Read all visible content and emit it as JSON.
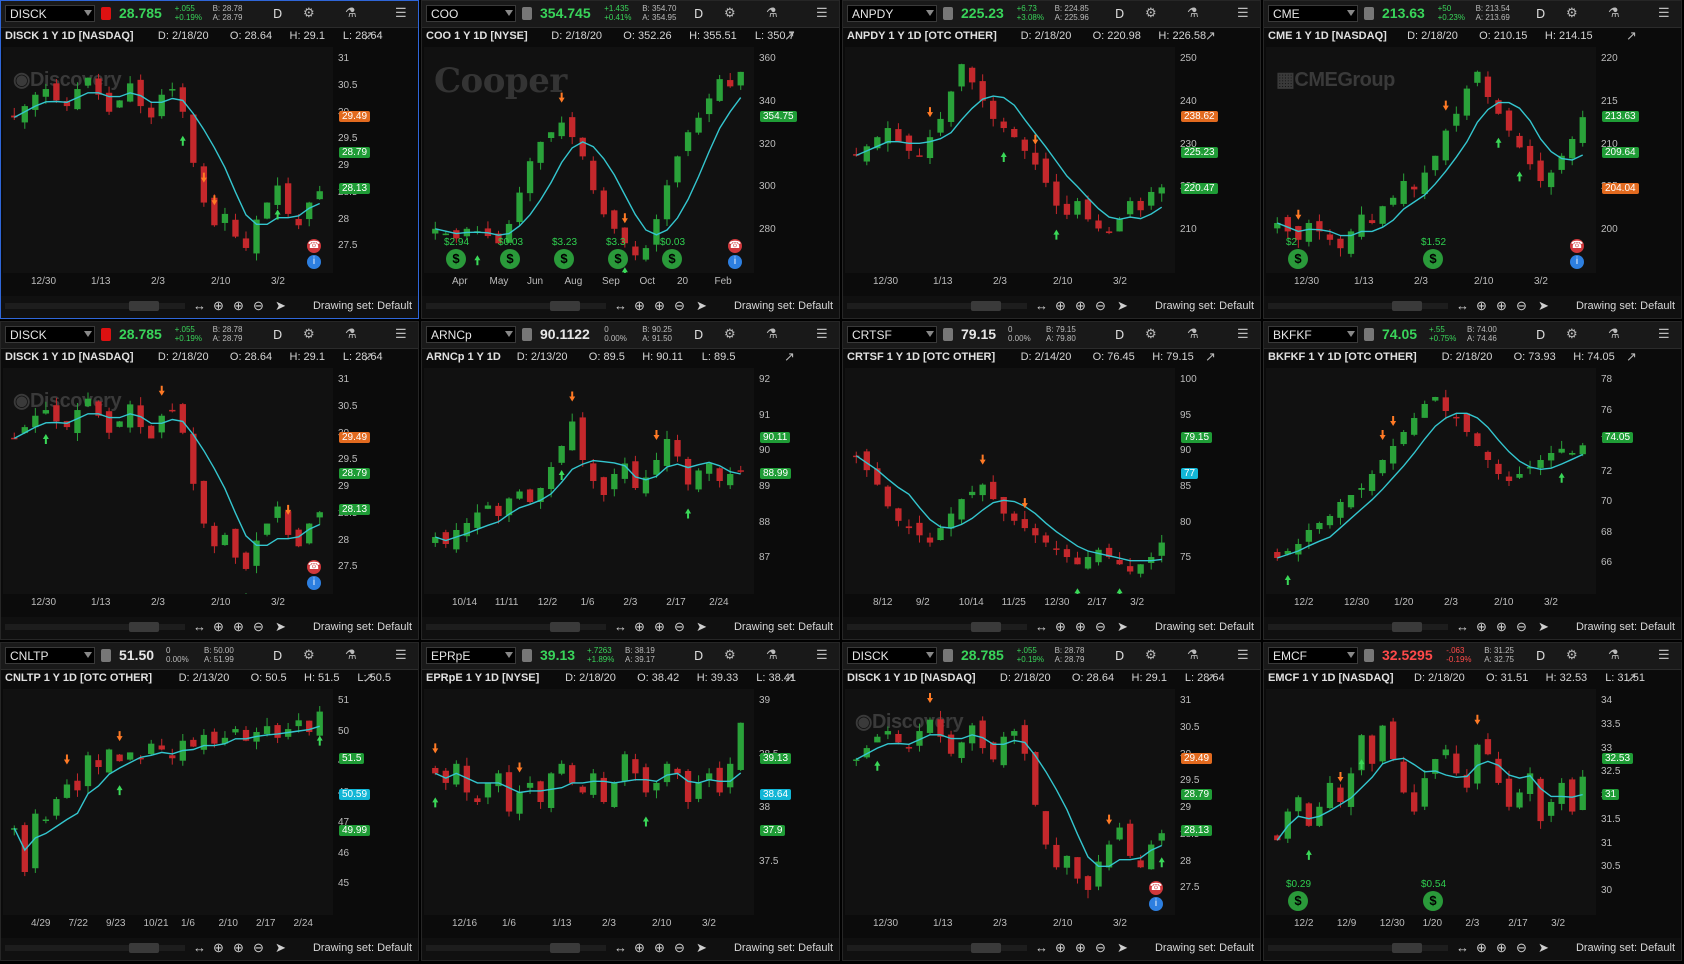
{
  "window": {
    "drawing_set": "Drawing set: Default"
  },
  "colors": {
    "up": "#2aa23a",
    "down": "#c4282c",
    "ma": "#34c6cf",
    "buy_arrow": "#3ad858",
    "sell_arrow": "#ff7a25",
    "green_badge": "#1f9c36",
    "orange_badge": "#e26a1f",
    "cyan_badge": "#12b6d6"
  },
  "icons": [
    "link-icon",
    "gear-icon",
    "flask-icon",
    "menu-icon",
    "drawing-icon",
    "pan-icon",
    "zoom-in-icon",
    "zoom-out-icon",
    "crosshair-icon",
    "cursor-icon",
    "dividend-icon",
    "earnings-icon",
    "buy-arrow-icon",
    "sell-arrow-icon"
  ],
  "panels": [
    {
      "symbol": "DISCK",
      "link_color": "#d11",
      "last": "28.785",
      "chg1": "+.055",
      "chg2": "+0.19%",
      "bid": "B: 28.78",
      "ask": "A: 28.79",
      "agg": "D",
      "title": "DISCK 1 Y 1D [NASDAQ]",
      "date": "D: 2/18/20",
      "open": "O: 28.64",
      "high": "H: 29.1",
      "low": "L: 28.64",
      "logo": "Discovery",
      "y_ticks": [
        "31",
        "30.5",
        "30",
        "29.5",
        "29",
        "28.5",
        "28",
        "27.5"
      ],
      "x_ticks": [
        "12/30",
        "1/13",
        "2/3",
        "2/10",
        "3/2"
      ],
      "badges": [
        {
          "text": "29.49",
          "color": "orange"
        },
        {
          "text": "28.79",
          "color": "green"
        },
        {
          "text": "28.13",
          "color": "green"
        }
      ],
      "dividends": [],
      "earnings": true,
      "chart_data": {
        "type": "candlestick",
        "ylim": [
          27.5,
          31.2
        ],
        "close": [
          30.1,
          30.3,
          30.5,
          30.6,
          30.4,
          30.3,
          30.6,
          30.8,
          30.5,
          30.2,
          30.4,
          30.7,
          30.3,
          30.1,
          30.5,
          30.6,
          30.2,
          29.3,
          28.6,
          28.2,
          28.4,
          28.0,
          27.8,
          28.3,
          28.6,
          28.9,
          28.4,
          28.2,
          28.6,
          28.8
        ]
      }
    },
    {
      "symbol": "COO",
      "link_color": "#777",
      "last": "354.745",
      "chg1": "+1.435",
      "chg2": "+0.41%",
      "bid": "B: 354.70",
      "ask": "A: 354.95",
      "agg": "D",
      "title": "COO 1 Y 1D [NYSE]",
      "date": "D: 2/18/20",
      "open": "O: 352.26",
      "high": "H: 355.51",
      "low": "L: 350.7",
      "logo": "Cooper",
      "y_ticks": [
        "360",
        "340",
        "320",
        "300",
        "280"
      ],
      "x_ticks": [
        "Apr",
        "May",
        "Jun",
        "Aug",
        "Sep",
        "Oct",
        "20",
        "Feb"
      ],
      "badges": [
        {
          "text": "354.75",
          "color": "green"
        }
      ],
      "dividends": [
        "$2.94",
        "$0.03",
        "$3.23",
        "$3.3",
        "$0.03"
      ],
      "earnings": true,
      "chart_data": {
        "type": "candlestick",
        "ylim": [
          275,
          362
        ],
        "close": [
          290,
          288,
          286,
          290,
          289,
          287,
          284,
          292,
          305,
          318,
          326,
          330,
          334,
          328,
          320,
          306,
          296,
          290,
          284,
          279,
          282,
          294,
          308,
          320,
          330,
          336,
          344,
          352,
          349,
          355
        ]
      }
    },
    {
      "symbol": "ANPDY",
      "link_color": "#777",
      "last": "225.23",
      "chg1": "+6.73",
      "chg2": "+3.08%",
      "bid": "B: 224.85",
      "ask": "A: 225.96",
      "agg": "D",
      "title": "ANPDY 1 Y 1D [OTC OTHER]",
      "date": "D: 2/18/20",
      "open": "O: 220.98",
      "high": "H: 226.58",
      "low": "",
      "logo": "",
      "y_ticks": [
        "250",
        "240",
        "230",
        "220",
        "210"
      ],
      "x_ticks": [
        "12/30",
        "1/13",
        "2/3",
        "2/10",
        "3/2"
      ],
      "badges": [
        {
          "text": "238.62",
          "color": "orange"
        },
        {
          "text": "225.23",
          "color": "green"
        },
        {
          "text": "220.47",
          "color": "green"
        }
      ],
      "dividends": [],
      "earnings": false,
      "chart_data": {
        "type": "candlestick",
        "ylim": [
          208,
          254
        ],
        "close": [
          232,
          234,
          236,
          238,
          235,
          233,
          232,
          236,
          240,
          246,
          252,
          248,
          244,
          240,
          238,
          236,
          233,
          230,
          226,
          221,
          219,
          222,
          218,
          216,
          215,
          218,
          222,
          220,
          224,
          225
        ]
      }
    },
    {
      "symbol": "CME",
      "link_color": "#777",
      "last": "213.63",
      "chg1": "+50",
      "chg2": "+0.23%",
      "bid": "B: 213.54",
      "ask": "A: 213.69",
      "agg": "D",
      "title": "CME 1 Y 1D [NASDAQ]",
      "date": "D: 2/18/20",
      "open": "O: 210.15",
      "high": "H: 214.15",
      "low": "",
      "logo": "CMEGroup",
      "y_ticks": [
        "220",
        "215",
        "210",
        "205",
        "200"
      ],
      "x_ticks": [
        "12/30",
        "1/13",
        "2/3",
        "2/10",
        "3/2"
      ],
      "badges": [
        {
          "text": "213.63",
          "color": "green"
        },
        {
          "text": "209.64",
          "color": "green"
        },
        {
          "text": "204.04",
          "color": "orange"
        }
      ],
      "dividends": [
        "$2",
        "$1.52"
      ],
      "earnings": true,
      "chart_data": {
        "type": "candlestick",
        "ylim": [
          196,
          221
        ],
        "close": [
          201,
          200,
          199,
          201,
          200,
          199,
          198,
          200,
          202,
          201,
          203,
          204,
          206,
          205,
          207,
          209,
          212,
          214,
          217,
          219,
          216,
          214,
          212,
          210,
          208,
          206,
          207,
          209,
          211,
          213.6
        ]
      }
    },
    {
      "symbol": "DISCK",
      "link_color": "#d11",
      "last": "28.785",
      "chg1": "+.055",
      "chg2": "+0.19%",
      "bid": "B: 28.78",
      "ask": "A: 28.79",
      "agg": "D",
      "title": "DISCK 1 Y 1D [NASDAQ]",
      "date": "D: 2/18/20",
      "open": "O: 28.64",
      "high": "H: 29.1",
      "low": "L: 28.64",
      "logo": "Discovery",
      "y_ticks": [
        "31",
        "30.5",
        "30",
        "29.5",
        "29",
        "28.5",
        "28",
        "27.5"
      ],
      "x_ticks": [
        "12/30",
        "1/13",
        "2/3",
        "2/10",
        "3/2"
      ],
      "badges": [
        {
          "text": "29.49",
          "color": "orange"
        },
        {
          "text": "28.79",
          "color": "green"
        },
        {
          "text": "28.13",
          "color": "green"
        }
      ],
      "dividends": [],
      "earnings": true,
      "chart_data": {
        "type": "candlestick",
        "ylim": [
          27.5,
          31.2
        ],
        "close": [
          30.1,
          30.3,
          30.5,
          30.6,
          30.4,
          30.3,
          30.6,
          30.8,
          30.5,
          30.2,
          30.4,
          30.7,
          30.3,
          30.1,
          30.5,
          30.6,
          30.2,
          29.3,
          28.6,
          28.2,
          28.4,
          28.0,
          27.8,
          28.3,
          28.6,
          28.9,
          28.4,
          28.2,
          28.6,
          28.8
        ]
      }
    },
    {
      "symbol": "ARNCp",
      "link_color": "#777",
      "last": "90.1122",
      "chg1": "0",
      "chg2": "0.00%",
      "bid": "B: 90.25",
      "ask": "A: 91.50",
      "agg": "D",
      "title": "ARNCp 1 Y 1D",
      "date": "D: 2/13/20",
      "open": "O: 89.5",
      "high": "H: 90.11",
      "low": "L: 89.5",
      "logo": "",
      "y_ticks": [
        "92",
        "91",
        "90",
        "89",
        "88",
        "87"
      ],
      "x_ticks": [
        "10/14",
        "11/11",
        "12/2",
        "1/6",
        "2/3",
        "2/17",
        "2/24"
      ],
      "badges": [
        {
          "text": "90.11",
          "color": "green"
        },
        {
          "text": "88.99",
          "color": "green"
        }
      ],
      "dividends": [],
      "earnings": false,
      "chart_data": {
        "type": "candlestick",
        "ylim": [
          86.8,
          92.8
        ],
        "close": [
          88.2,
          88.0,
          88.4,
          88.6,
          88.9,
          89.1,
          88.8,
          89.3,
          89.5,
          89.2,
          89.6,
          90.2,
          90.8,
          91.5,
          90.4,
          89.8,
          89.4,
          90.0,
          90.3,
          89.6,
          89.9,
          90.4,
          91.0,
          90.5,
          89.7,
          90.1,
          90.3,
          89.8,
          90.0,
          90.1
        ]
      }
    },
    {
      "symbol": "CRTSF",
      "link_color": "#777",
      "last": "79.15",
      "chg1": "0",
      "chg2": "0.00%",
      "bid": "B: 79.15",
      "ask": "A: 79.80",
      "agg": "D",
      "title": "CRTSF 1 Y 1D [OTC OTHER]",
      "date": "D: 2/14/20",
      "open": "O: 76.45",
      "high": "H: 79.15",
      "low": "",
      "logo": "",
      "y_ticks": [
        "100",
        "95",
        "90",
        "85",
        "80",
        "75"
      ],
      "x_ticks": [
        "8/12",
        "9/2",
        "10/14",
        "11/25",
        "12/30",
        "2/17",
        "3/2"
      ],
      "badges": [
        {
          "text": "79.15",
          "color": "green"
        },
        {
          "text": "77",
          "color": "cyan"
        }
      ],
      "dividends": [],
      "earnings": false,
      "chart_data": {
        "type": "candlestick",
        "ylim": [
          73,
          102
        ],
        "close": [
          91,
          89,
          87,
          84,
          82,
          81,
          80,
          79,
          81,
          83,
          85,
          86,
          87,
          85,
          83,
          82,
          81,
          80,
          79,
          78,
          77,
          76,
          77,
          78,
          77,
          76,
          75,
          76,
          77,
          79
        ]
      }
    },
    {
      "symbol": "BKFKF",
      "link_color": "#777",
      "last": "74.05",
      "chg1": "+.55",
      "chg2": "+0.75%",
      "bid": "B: 74.00",
      "ask": "A: 74.46",
      "agg": "D",
      "title": "BKFKF 1 Y 1D [OTC OTHER]",
      "date": "D: 2/18/20",
      "open": "O: 73.93",
      "high": "H: 74.05",
      "low": "",
      "logo": "",
      "y_ticks": [
        "78",
        "76",
        "74",
        "72",
        "70",
        "68",
        "66"
      ],
      "x_ticks": [
        "12/2",
        "12/30",
        "1/20",
        "2/3",
        "2/10",
        "3/2"
      ],
      "badges": [
        {
          "text": "74.05",
          "color": "green"
        }
      ],
      "dividends": [],
      "earnings": false,
      "chart_data": {
        "type": "candlestick",
        "ylim": [
          64,
          79
        ],
        "close": [
          66,
          66.5,
          67,
          68,
          68.5,
          69,
          70,
          70.5,
          71,
          72,
          73,
          74,
          75,
          76,
          77,
          77.5,
          76.5,
          76,
          75,
          74,
          73,
          72,
          71.5,
          72,
          72.5,
          73,
          73.5,
          73.8,
          73.5,
          74.05
        ]
      }
    },
    {
      "symbol": "CNLTP",
      "link_color": "#777",
      "last": "51.50",
      "chg1": "0",
      "chg2": "0.00%",
      "bid": "B: 50.00",
      "ask": "A: 51.99",
      "agg": "D",
      "title": "CNLTP 1 Y 1D [OTC OTHER]",
      "date": "D: 2/13/20",
      "open": "O: 50.5",
      "high": "H: 51.5",
      "low": "L: 50.5",
      "logo": "",
      "y_ticks": [
        "51",
        "50",
        "49",
        "48",
        "47",
        "46",
        "45"
      ],
      "x_ticks": [
        "4/29",
        "7/22",
        "9/23",
        "10/21",
        "1/6",
        "2/10",
        "2/17",
        "2/24"
      ],
      "badges": [
        {
          "text": "51.5",
          "color": "green"
        },
        {
          "text": "50.59",
          "color": "cyan"
        },
        {
          "text": "49.99",
          "color": "green"
        }
      ],
      "dividends": [],
      "earnings": false,
      "chart_data": {
        "type": "candlestick",
        "ylim": [
          44.8,
          52
        ],
        "close": [
          47.5,
          46,
          48,
          47.8,
          48.5,
          49,
          48.8,
          50,
          49.6,
          50.2,
          49.8,
          50.1,
          49.9,
          50.4,
          50.2,
          49.9,
          50.5,
          50.3,
          50.7,
          50.4,
          50.6,
          50.9,
          50.5,
          50.8,
          51.0,
          50.6,
          50.9,
          51.2,
          50.8,
          51.5
        ]
      }
    },
    {
      "symbol": "EPRpE",
      "link_color": "#777",
      "last": "39.13",
      "chg1": "+.7263",
      "chg2": "+1.89%",
      "bid": "B: 38.19",
      "ask": "A: 39.17",
      "agg": "D",
      "title": "EPRpE 1 Y 1D [NYSE]",
      "date": "D: 2/18/20",
      "open": "O: 38.42",
      "high": "H: 39.33",
      "low": "L: 38.41",
      "logo": "",
      "y_ticks": [
        "39",
        "38.5",
        "38",
        "37.5"
      ],
      "x_ticks": [
        "12/16",
        "1/6",
        "1/13",
        "2/3",
        "2/10",
        "3/2"
      ],
      "badges": [
        {
          "text": "39.13",
          "color": "green"
        },
        {
          "text": "38.64",
          "color": "cyan"
        },
        {
          "text": "37.9",
          "color": "green"
        }
      ],
      "dividends": [],
      "earnings": false,
      "chart_data": {
        "type": "candlestick",
        "ylim": [
          37.2,
          39.4
        ],
        "close": [
          38.6,
          38.5,
          38.7,
          38.4,
          38.3,
          38.5,
          38.6,
          38.2,
          38.4,
          38.5,
          38.3,
          38.6,
          38.7,
          38.5,
          38.4,
          38.6,
          38.3,
          38.5,
          38.8,
          38.6,
          38.4,
          38.5,
          38.7,
          38.6,
          38.3,
          38.5,
          38.6,
          38.4,
          38.7,
          39.13
        ]
      }
    },
    {
      "symbol": "DISCK",
      "link_color": "#777",
      "last": "28.785",
      "chg1": "+.055",
      "chg2": "+0.19%",
      "bid": "B: 28.78",
      "ask": "A: 28.79",
      "agg": "D",
      "title": "DISCK 1 Y 1D [NASDAQ]",
      "date": "D: 2/18/20",
      "open": "O: 28.64",
      "high": "H: 29.1",
      "low": "L: 28.64",
      "logo": "Discovery",
      "y_ticks": [
        "31",
        "30.5",
        "30",
        "29.5",
        "29",
        "28.5",
        "28",
        "27.5"
      ],
      "x_ticks": [
        "12/30",
        "1/13",
        "2/3",
        "2/10",
        "3/2"
      ],
      "badges": [
        {
          "text": "29.49",
          "color": "orange"
        },
        {
          "text": "28.79",
          "color": "green"
        },
        {
          "text": "28.13",
          "color": "green"
        }
      ],
      "dividends": [],
      "earnings": true,
      "chart_data": {
        "type": "candlestick",
        "ylim": [
          27.5,
          31.2
        ],
        "close": [
          30.1,
          30.3,
          30.5,
          30.6,
          30.4,
          30.3,
          30.6,
          30.8,
          30.5,
          30.2,
          30.4,
          30.7,
          30.3,
          30.1,
          30.5,
          30.6,
          30.2,
          29.3,
          28.6,
          28.2,
          28.4,
          28.0,
          27.8,
          28.3,
          28.6,
          28.9,
          28.4,
          28.2,
          28.6,
          28.8
        ]
      }
    },
    {
      "symbol": "EMCF",
      "link_color": "#777",
      "last": "32.5295",
      "chg1": "-.063",
      "chg2": "-0.19%",
      "bid": "B: 31.25",
      "ask": "A: 32.75",
      "agg": "D",
      "title": "EMCF 1 Y 1D [NASDAQ]",
      "date": "D: 2/18/20",
      "open": "O: 31.51",
      "high": "H: 32.53",
      "low": "L: 31.51",
      "logo": "",
      "y_ticks": [
        "34",
        "33.5",
        "33",
        "32.5",
        "32",
        "31.5",
        "31",
        "30.5",
        "30"
      ],
      "x_ticks": [
        "12/2",
        "12/9",
        "12/30",
        "1/20",
        "2/3",
        "2/17",
        "3/2"
      ],
      "badges": [
        {
          "text": "32.53",
          "color": "green"
        },
        {
          "text": "31",
          "color": "green"
        }
      ],
      "dividends": [
        "$0.29",
        "$0.54"
      ],
      "earnings": false,
      "chart_data": {
        "type": "candlestick",
        "ylim": [
          29.8,
          34.2
        ],
        "close": [
          31.2,
          31.8,
          32.1,
          31.5,
          31.9,
          32.4,
          32.0,
          32.6,
          33.4,
          32.8,
          33.6,
          32.9,
          32.2,
          31.8,
          32.5,
          32.9,
          33.1,
          32.6,
          32.3,
          33.2,
          33.0,
          32.4,
          31.9,
          32.2,
          32.6,
          31.6,
          32.0,
          32.4,
          31.8,
          32.53
        ]
      }
    }
  ]
}
